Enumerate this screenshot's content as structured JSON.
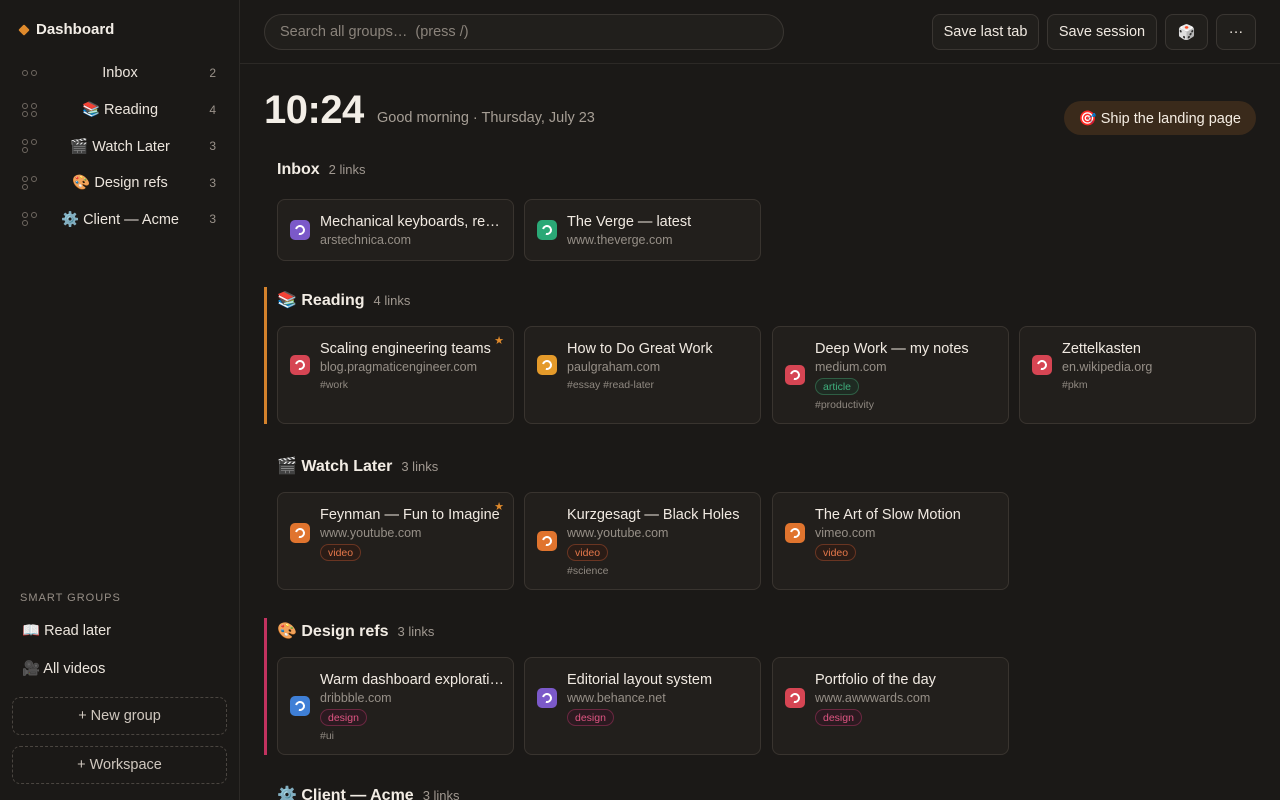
{
  "sidebar": {
    "brand": "Dashboard",
    "groups": [
      {
        "label": "Inbox",
        "count": "2"
      },
      {
        "label": "📚 Reading",
        "count": "4"
      },
      {
        "label": "🎬 Watch Later",
        "count": "3"
      },
      {
        "label": "🎨 Design refs",
        "count": "3"
      },
      {
        "label": "⚙️ Client — Acme",
        "count": "3"
      }
    ],
    "smart_groups_title": "SMART GROUPS",
    "smart_groups": [
      "📖 Read later",
      "🎥 All videos"
    ],
    "new_group": "+ New group",
    "workspace": "+ Workspace"
  },
  "topbar": {
    "search_placeholder": "Search all groups…  (press /)",
    "save_last_tab": "Save last tab",
    "save_session": "Save session",
    "dice_icon": "🎲",
    "more_icon": "···"
  },
  "header": {
    "clock": "10:24",
    "greeting": "Good morning · Thursday, July 23",
    "focus": "🎯 Ship the landing page"
  },
  "colors": {
    "accent": "#e08a2c",
    "reading_border": "#d4822c",
    "design_border": "#c2325f"
  },
  "groups": {
    "inbox": {
      "title": "Inbox",
      "count": "2 links",
      "cards": [
        {
          "title": "Mechanical keyboards, reviewed",
          "domain": "arstechnica.com",
          "favicon_color": "#7b59c9"
        },
        {
          "title": "The Verge — latest",
          "domain": "www.theverge.com",
          "favicon_color": "#2aa876"
        }
      ]
    },
    "reading": {
      "title": "📚 Reading",
      "count": "4 links",
      "cards": [
        {
          "title": "Scaling engineering teams",
          "domain": "blog.pragmaticengineer.com",
          "tags": "#work",
          "starred": "★",
          "favicon_color": "#d64553"
        },
        {
          "title": "How to Do Great Work",
          "domain": "paulgraham.com",
          "tags": "#essay  #read-later",
          "favicon_color": "#e49a2a"
        },
        {
          "title": "Deep Work — my notes",
          "domain": "medium.com",
          "badge": "article",
          "tags": "#productivity",
          "favicon_color": "#d64553"
        },
        {
          "title": "Zettelkasten",
          "domain": "en.wikipedia.org",
          "tags": "#pkm",
          "favicon_color": "#d64553"
        }
      ]
    },
    "watch": {
      "title": "🎬 Watch Later",
      "count": "3 links",
      "cards": [
        {
          "title": "Feynman — Fun to Imagine",
          "domain": "www.youtube.com",
          "badge": "video",
          "starred": "★",
          "favicon_color": "#e0742e"
        },
        {
          "title": "Kurzgesagt — Black Holes",
          "domain": "www.youtube.com",
          "badge": "video",
          "tags": "#science",
          "favicon_color": "#e0742e"
        },
        {
          "title": "The Art of Slow Motion",
          "domain": "vimeo.com",
          "badge": "video",
          "favicon_color": "#e0742e"
        }
      ]
    },
    "design": {
      "title": "🎨 Design refs",
      "count": "3 links",
      "cards": [
        {
          "title": "Warm dashboard exploration",
          "domain": "dribbble.com",
          "badge": "design",
          "tags": "#ui",
          "favicon_color": "#3f7fd6"
        },
        {
          "title": "Editorial layout system",
          "domain": "www.behance.net",
          "badge": "design",
          "favicon_color": "#7b59c9"
        },
        {
          "title": "Portfolio of the day",
          "domain": "www.awwwards.com",
          "badge": "design",
          "favicon_color": "#d64553"
        }
      ]
    },
    "client": {
      "title": "⚙️ Client — Acme",
      "count": "3 links"
    }
  }
}
